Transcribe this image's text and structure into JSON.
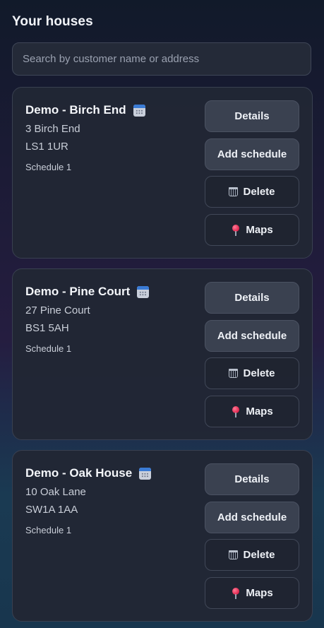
{
  "header": {
    "title": "Your houses"
  },
  "search": {
    "placeholder": "Search by customer name or address",
    "value": ""
  },
  "houses": [
    {
      "name": "Demo - Birch End",
      "address_line1": "3 Birch End",
      "postcode": "LS1 1UR",
      "schedule": "Schedule 1",
      "buttons": {
        "details": "Details",
        "add_schedule": "Add schedule",
        "delete": "Delete",
        "maps": "Maps"
      }
    },
    {
      "name": "Demo - Pine Court",
      "address_line1": "27 Pine Court",
      "postcode": "BS1 5AH",
      "schedule": "Schedule 1",
      "buttons": {
        "details": "Details",
        "add_schedule": "Add schedule",
        "delete": "Delete",
        "maps": "Maps"
      }
    },
    {
      "name": "Demo - Oak House",
      "address_line1": "10 Oak Lane",
      "postcode": "SW1A 1AA",
      "schedule": "Schedule 1",
      "buttons": {
        "details": "Details",
        "add_schedule": "Add schedule",
        "delete": "Delete",
        "maps": "Maps"
      }
    }
  ],
  "icons": {
    "calendar": "calendar-icon",
    "delete": "trash-icon",
    "maps": "map-pin-icon"
  },
  "colors": {
    "background": "#151c2c",
    "card": "#212734",
    "button": "#3a4150",
    "accent_pin": "#e0244d"
  }
}
